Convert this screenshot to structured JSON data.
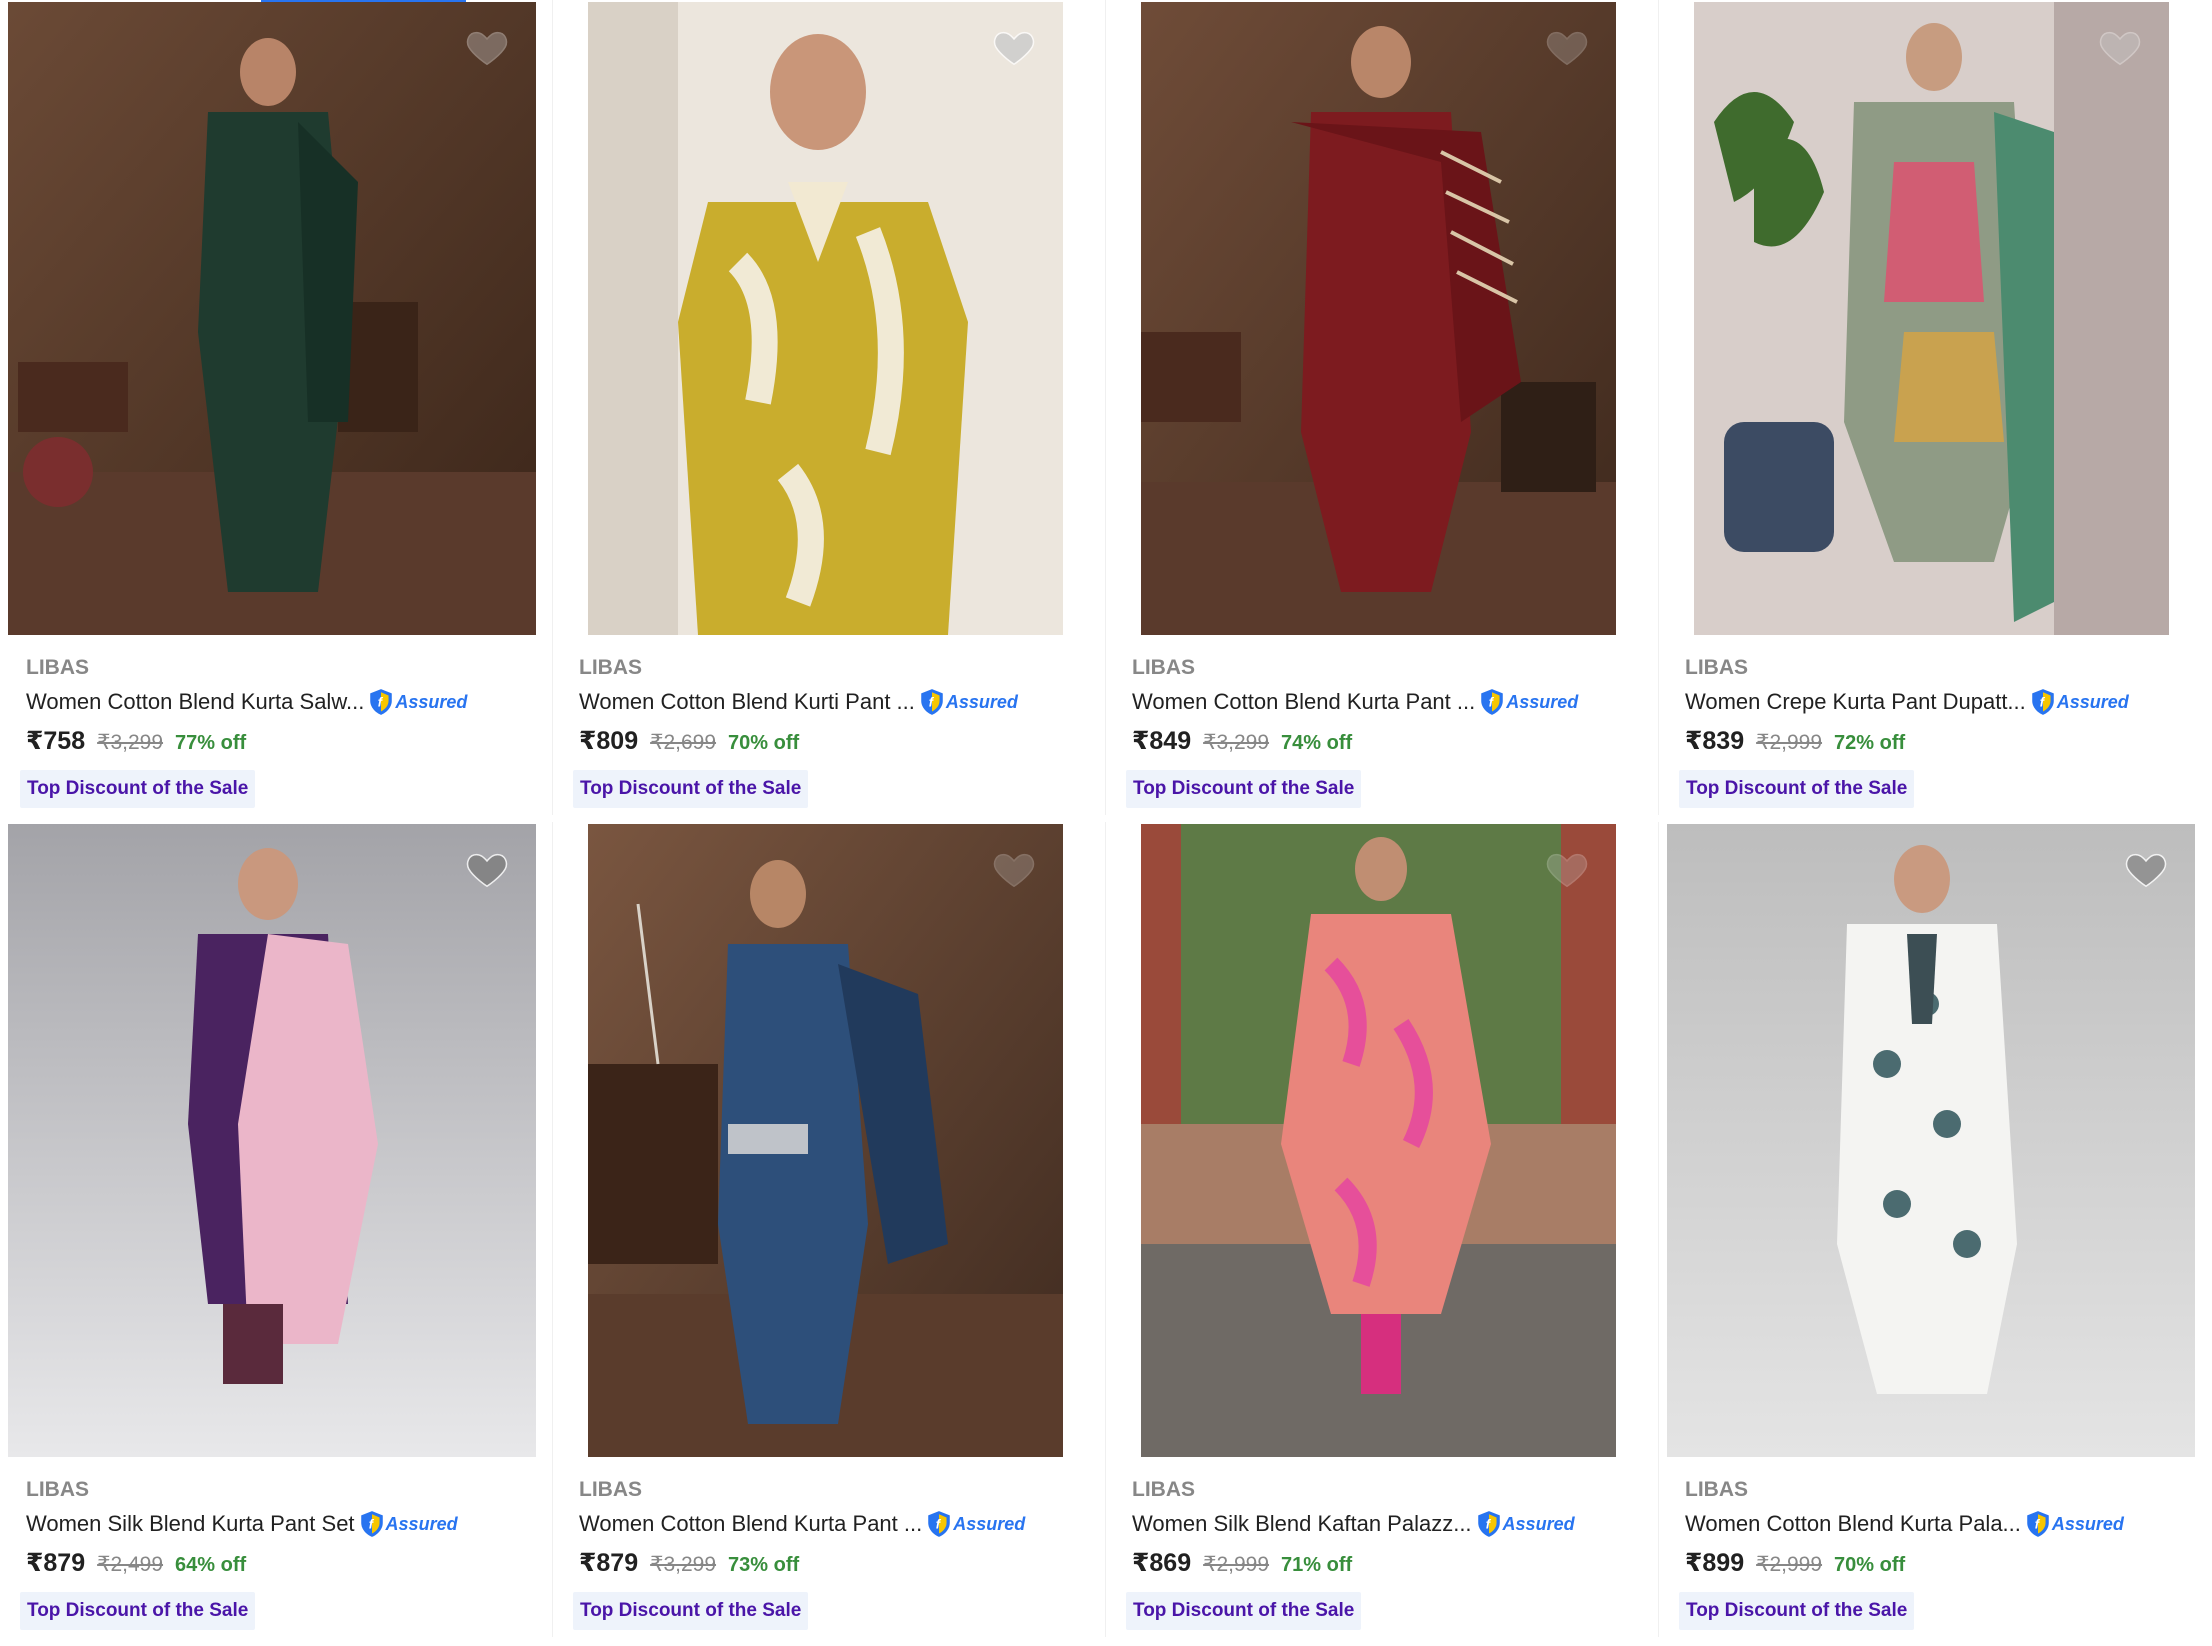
{
  "products": [
    {
      "brand": "LIBAS",
      "title": "Women Cotton Blend Kurta Salw...",
      "assured": "Assured",
      "price": "₹758",
      "mrp": "₹3,299",
      "discount": "77% off",
      "tag": "Top Discount of the Sale",
      "image": "dark green kurta salwar set"
    },
    {
      "brand": "LIBAS",
      "title": "Women Cotton Blend Kurti Pant ...",
      "assured": "Assured",
      "price": "₹809",
      "mrp": "₹2,699",
      "discount": "70% off",
      "tag": "Top Discount of the Sale",
      "image": "mustard yellow printed kurti"
    },
    {
      "brand": "LIBAS",
      "title": "Women Cotton Blend Kurta Pant ...",
      "assured": "Assured",
      "price": "₹849",
      "mrp": "₹3,299",
      "discount": "74% off",
      "tag": "Top Discount of the Sale",
      "image": "maroon kurta pant dupatta"
    },
    {
      "brand": "LIBAS",
      "title": "Women Crepe Kurta Pant Dupatt...",
      "assured": "Assured",
      "price": "₹839",
      "mrp": "₹2,999",
      "discount": "72% off",
      "tag": "Top Discount of the Sale",
      "image": "green printed crepe kurta set"
    },
    {
      "brand": "LIBAS",
      "title": "Women Silk Blend Kurta Pant Set",
      "assured": "Assured",
      "price": "₹879",
      "mrp": "₹2,499",
      "discount": "64% off",
      "tag": "Top Discount of the Sale",
      "image": "purple kurta with pink dupatta"
    },
    {
      "brand": "LIBAS",
      "title": "Women Cotton Blend Kurta Pant ...",
      "assured": "Assured",
      "price": "₹879",
      "mrp": "₹3,299",
      "discount": "73% off",
      "tag": "Top Discount of the Sale",
      "image": "navy blue kurta pant set"
    },
    {
      "brand": "LIBAS",
      "title": "Women Silk Blend Kaftan Palazz...",
      "assured": "Assured",
      "price": "₹869",
      "mrp": "₹2,999",
      "discount": "71% off",
      "tag": "Top Discount of the Sale",
      "image": "pink floral kaftan palazzo"
    },
    {
      "brand": "LIBAS",
      "title": "Women Cotton Blend Kurta Pala...",
      "assured": "Assured",
      "price": "₹899",
      "mrp": "₹2,999",
      "discount": "70% off",
      "tag": "Top Discount of the Sale",
      "image": "white printed kurta palazzo"
    }
  ],
  "colors": {
    "brand_gray": "#878787",
    "price_text": "#212121",
    "discount_green": "#388e3c",
    "assured_blue": "#2874f0",
    "tag_text": "#4a15a8",
    "tag_bg": "#eef3fb"
  },
  "icons": {
    "wishlist": "heart-icon",
    "assured": "assured-badge-icon"
  }
}
